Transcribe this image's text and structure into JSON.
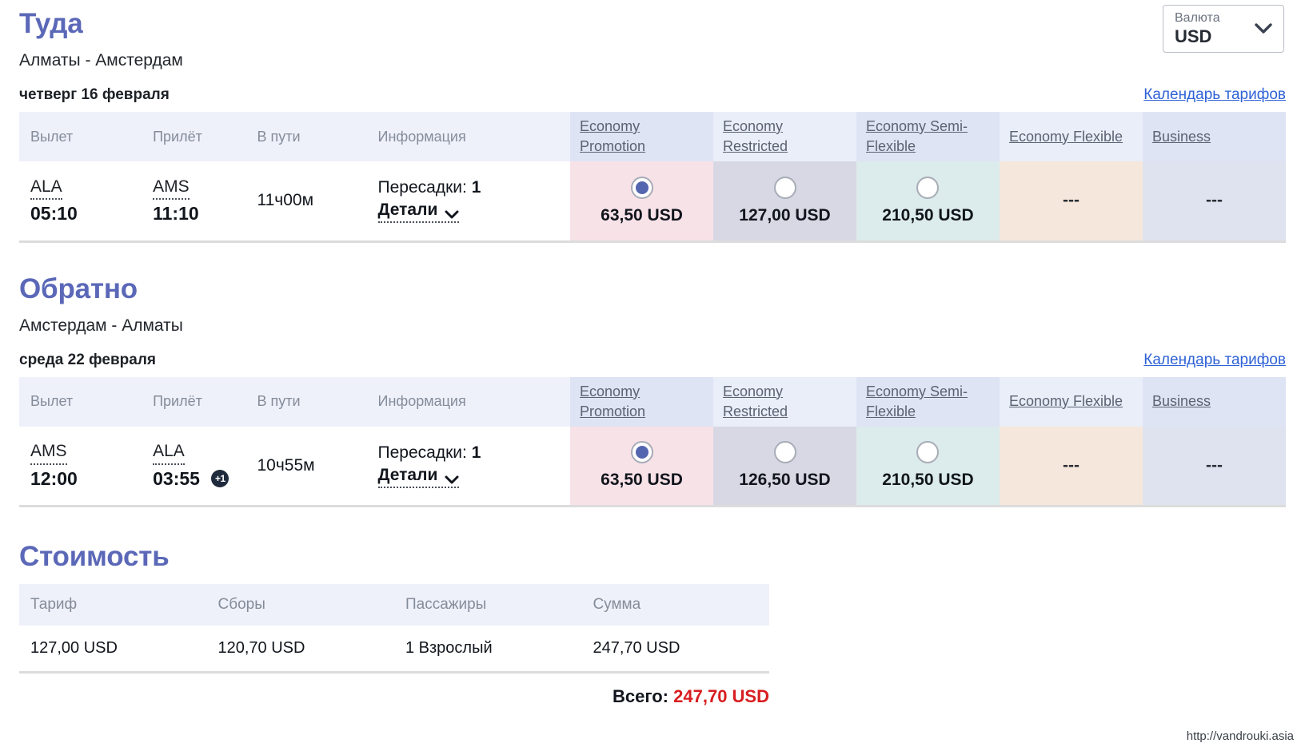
{
  "currency": {
    "label": "Валюта",
    "value": "USD",
    "chevron_icon": "chevron-down-icon"
  },
  "outbound": {
    "title": "Туда",
    "route": "Алматы - Амстердам",
    "date": "четверг 16 февраля",
    "calendar_link": "Календарь тарифов",
    "columns": [
      "Вылет",
      "Прилёт",
      "В пути",
      "Информация"
    ],
    "fare_classes": [
      "Economy Promotion",
      "Economy Restricted",
      "Economy Semi-Flexible",
      "Economy Flexible",
      "Business"
    ],
    "flight": {
      "depart_code": "ALA",
      "depart_time": "05:10",
      "arrive_code": "AMS",
      "arrive_time": "11:10",
      "arrive_day_offset": "",
      "duration": "11ч00м",
      "stops_label": "Пересадки:",
      "stops_count": "1",
      "details_label": "Детали",
      "fares": [
        {
          "price": "63,50 USD",
          "selected": true,
          "available": true
        },
        {
          "price": "127,00 USD",
          "selected": false,
          "available": true
        },
        {
          "price": "210,50 USD",
          "selected": false,
          "available": true
        },
        {
          "price": "---",
          "selected": false,
          "available": false
        },
        {
          "price": "---",
          "selected": false,
          "available": false
        }
      ]
    }
  },
  "inbound": {
    "title": "Обратно",
    "route": "Амстердам - Алматы",
    "date": "среда 22 февраля",
    "calendar_link": "Календарь тарифов",
    "columns": [
      "Вылет",
      "Прилёт",
      "В пути",
      "Информация"
    ],
    "fare_classes": [
      "Economy Promotion",
      "Economy Restricted",
      "Economy Semi-Flexible",
      "Economy Flexible",
      "Business"
    ],
    "flight": {
      "depart_code": "AMS",
      "depart_time": "12:00",
      "arrive_code": "ALA",
      "arrive_time": "03:55",
      "arrive_day_offset": "+1",
      "duration": "10ч55м",
      "stops_label": "Пересадки:",
      "stops_count": "1",
      "details_label": "Детали",
      "fares": [
        {
          "price": "63,50 USD",
          "selected": true,
          "available": true
        },
        {
          "price": "126,50 USD",
          "selected": false,
          "available": true
        },
        {
          "price": "210,50 USD",
          "selected": false,
          "available": true
        },
        {
          "price": "---",
          "selected": false,
          "available": false
        },
        {
          "price": "---",
          "selected": false,
          "available": false
        }
      ]
    }
  },
  "cost": {
    "title": "Стоимость",
    "columns": [
      "Тариф",
      "Сборы",
      "Пассажиры",
      "Сумма"
    ],
    "row": [
      "127,00 USD",
      "120,70 USD",
      "1 Взрослый",
      "247,70 USD"
    ],
    "total_label": "Всего:",
    "total_amount": "247,70 USD"
  },
  "watermark": "http://vandrouki.asia"
}
